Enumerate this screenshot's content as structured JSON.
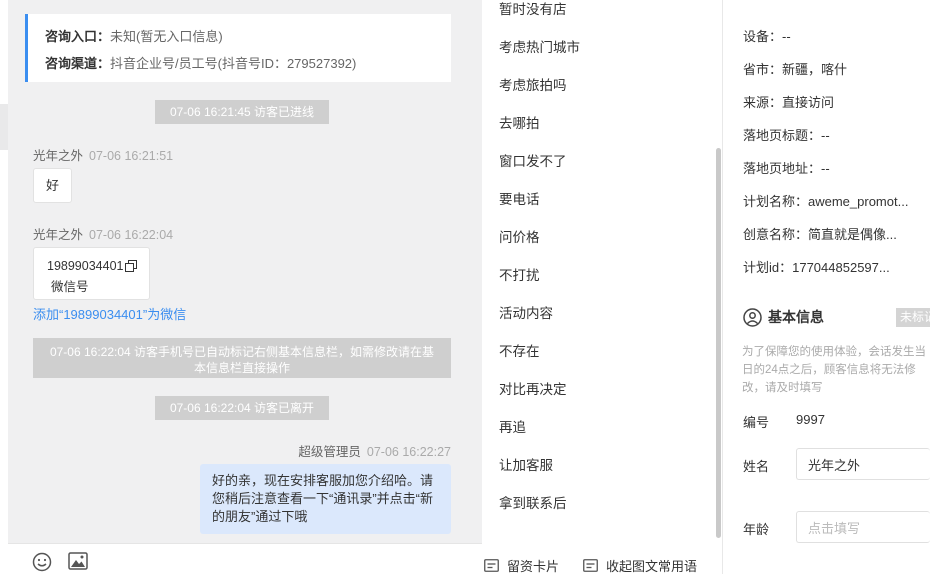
{
  "chat": {
    "info_card": {
      "entry_label": "咨询入口：",
      "entry_value": "未知(暂无入口信息)",
      "channel_label": "咨询渠道：",
      "channel_value": "抖音企业号/员工号(抖音号ID：279527392)"
    },
    "system_messages": [
      "07-06 16:21:45 访客已进线",
      "07-06 16:22:04 访客手机号已自动标记右侧基本信息栏，如需修改请在基本信息栏直接操作",
      "07-06 16:22:04 访客已离开"
    ],
    "messages": [
      {
        "sender": "光年之外",
        "time": "07-06 16:21:51",
        "text": "好"
      },
      {
        "sender": "光年之外",
        "time": "07-06 16:22:04",
        "number": "19899034401",
        "sub": "微信号",
        "link": "添加“19899034401”为微信"
      },
      {
        "sender": "超级管理员",
        "time": "07-06 16:22:27",
        "text": "好的亲，现在安排客服加您介绍哈。请您稍后注意查看一下“通讯录”并点击“新的朋友”通过下哦"
      }
    ],
    "toolbar": {
      "emoji_icon": "emoji-icon",
      "image_icon": "image-icon"
    }
  },
  "quick_replies": [
    "暂时没有店",
    "考虑热门城市",
    "考虑旅拍吗",
    "去哪拍",
    "窗口发不了",
    "要电话",
    "问价格",
    "不打扰",
    "活动内容",
    "不存在",
    "对比再决定",
    "再追",
    "让加客服",
    "拿到联系后"
  ],
  "footer": {
    "card_button": "留资卡片",
    "collapse_button": "收起图文常用语"
  },
  "right_panel": {
    "device": "设备：--",
    "region": "省市：新疆，喀什",
    "source": "来源：直接访问",
    "landing_title": "落地页标题：--",
    "landing_url": "落地页地址：--",
    "plan_name": "计划名称：aweme_promot...",
    "creative_name": "创意名称：简直就是偶像...",
    "plan_id": "计划id：177044852597...",
    "section_title": "基本信息",
    "tag": "未标记",
    "hint": "为了保障您的使用体验，会话发生当日的24点之后，顾客信息将无法修改，请及时填写",
    "number_label": "编号",
    "number_value": "9997",
    "name_label": "姓名",
    "name_value": "光年之外",
    "age_label": "年龄",
    "age_placeholder": "点击填写"
  },
  "colors": {
    "accent": "#3b8ef0",
    "bubble_self": "#dbe8fc",
    "system_pill": "#cfcfcf"
  }
}
